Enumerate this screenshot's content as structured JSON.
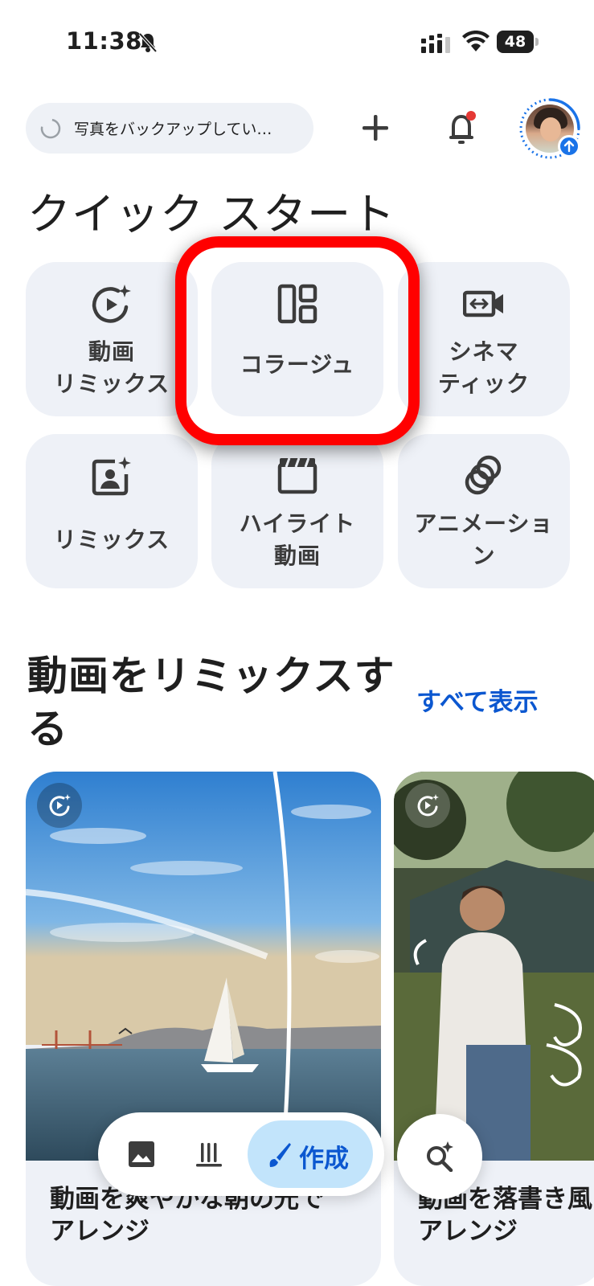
{
  "status_bar": {
    "time": "11:38",
    "battery": "48",
    "icons": [
      "bell-off-icon",
      "signal-icon",
      "wifi-icon",
      "battery-icon"
    ]
  },
  "top_bar": {
    "backup_status": "写真をバックアップしてい…",
    "icons": [
      "spinner-icon",
      "plus-icon",
      "notification-bell-icon",
      "avatar",
      "upload-badge-icon"
    ],
    "notification_dot_color": "#e53935",
    "accent_color": "#1a73e8"
  },
  "quick_start": {
    "title": "クイック スタート",
    "tiles": [
      {
        "label_line1": "動画",
        "label_line2": "リミックス",
        "icon": "video-remix-icon"
      },
      {
        "label_line1": "コラージュ",
        "label_line2": "",
        "icon": "collage-icon"
      },
      {
        "label_line1": "シネマ",
        "label_line2": "ティック",
        "icon": "cinematic-icon"
      },
      {
        "label_line1": "リミックス",
        "label_line2": "",
        "icon": "photo-remix-icon"
      },
      {
        "label_line1": "ハイライト",
        "label_line2": "動画",
        "icon": "highlight-video-icon"
      },
      {
        "label_line1": "アニメーショ",
        "label_line2": "ン",
        "icon": "animation-icon"
      }
    ],
    "highlight_color": "#ff0000"
  },
  "remix_section": {
    "title": "動画をリミックスする",
    "see_all": "すべて表示",
    "cards": [
      {
        "caption_line1": "動画を爽やかな朝の光で",
        "caption_line2": "アレンジ"
      },
      {
        "caption_line1": "動画を落書き風",
        "caption_line2": "アレンジ"
      }
    ]
  },
  "bottom_nav": {
    "create_label": "作成",
    "icons": [
      "photos-icon",
      "library-icon",
      "brush-icon",
      "search-sparkle-icon"
    ]
  }
}
